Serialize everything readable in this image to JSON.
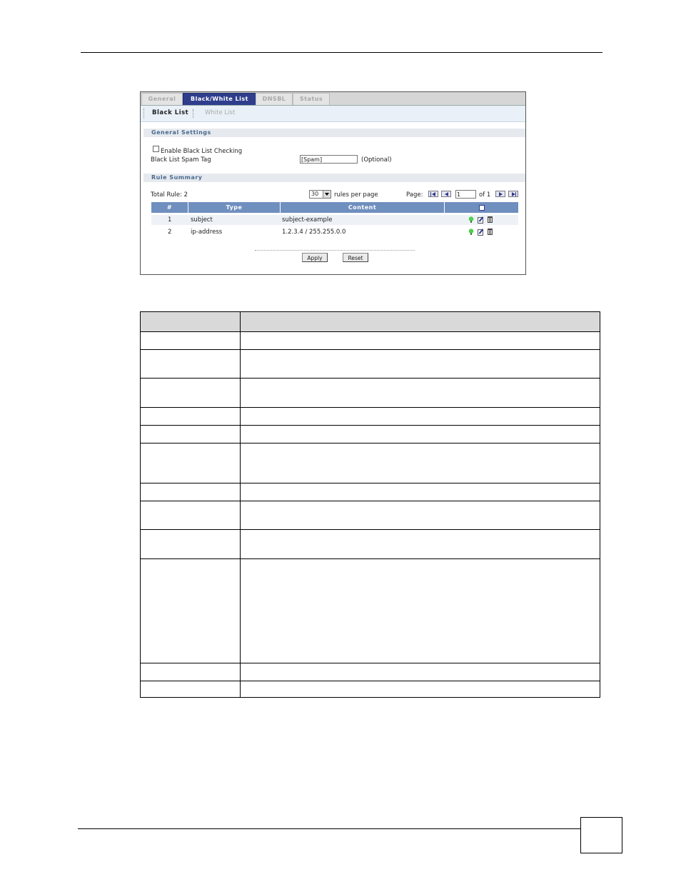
{
  "tabs": [
    "General",
    "Black/White List",
    "DNSBL",
    "Status"
  ],
  "subtabs": [
    "Black List",
    "White List"
  ],
  "general_settings": {
    "title": "General Settings",
    "enable_label": "Enable Black List Checking",
    "spam_tag_label": "Black List Spam Tag",
    "spam_tag_value": "[Spam]",
    "optional": "(Optional)"
  },
  "rule_summary": {
    "title": "Rule Summary",
    "total": "Total Rule: 2",
    "per_page_value": "30",
    "per_page_label": "rules per page",
    "page_label": "Page:",
    "page_value": "1",
    "page_of": "of 1",
    "columns": [
      "#",
      "Type",
      "Content"
    ],
    "rows": [
      {
        "num": "1",
        "type": "subject",
        "content": "subject-example"
      },
      {
        "num": "2",
        "type": "ip-address",
        "content": "1.2.3.4 / 255.255.0.0"
      }
    ]
  },
  "buttons": {
    "apply": "Apply",
    "reset": "Reset"
  },
  "icons": {
    "head": "add-icon",
    "row": [
      "active-bulb-icon",
      "edit-icon",
      "delete-icon"
    ]
  }
}
